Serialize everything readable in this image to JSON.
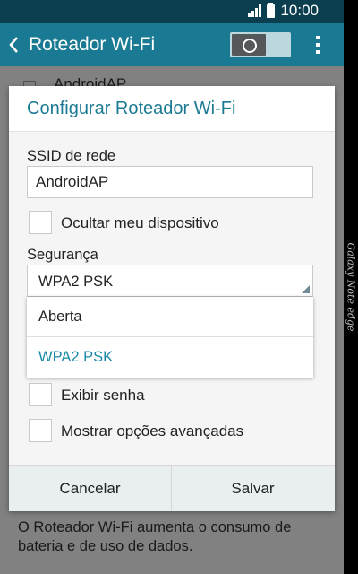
{
  "status_bar": {
    "time": "10:00",
    "icons": [
      "signal-icon",
      "battery-icon"
    ]
  },
  "action_bar": {
    "title": "Roteador Wi-Fi",
    "toggle_on": false,
    "icons": [
      "back-arrow-icon",
      "overflow-menu-icon"
    ]
  },
  "background": {
    "list_item": "AndroidAP",
    "footer_text": "O Roteador Wi-Fi aumenta o consumo de bateria e de uso de dados."
  },
  "dialog": {
    "title": "Configurar Roteador Wi-Fi",
    "ssid_label": "SSID de rede",
    "ssid_value": "AndroidAP",
    "hide_device_label": "Ocultar meu dispositivo",
    "security_label": "Segurança",
    "security_selected": "WPA2 PSK",
    "security_options": [
      "Aberta",
      "WPA2 PSK"
    ],
    "show_password_label": "Exibir senha",
    "advanced_label": "Mostrar opções avançadas",
    "cancel_label": "Cancelar",
    "save_label": "Salvar"
  },
  "device_label": "Galaxy Note edge",
  "colors": {
    "accent": "#1b7a93",
    "status_bar": "#0b3f4f",
    "selected_option": "#1b8aa8"
  }
}
